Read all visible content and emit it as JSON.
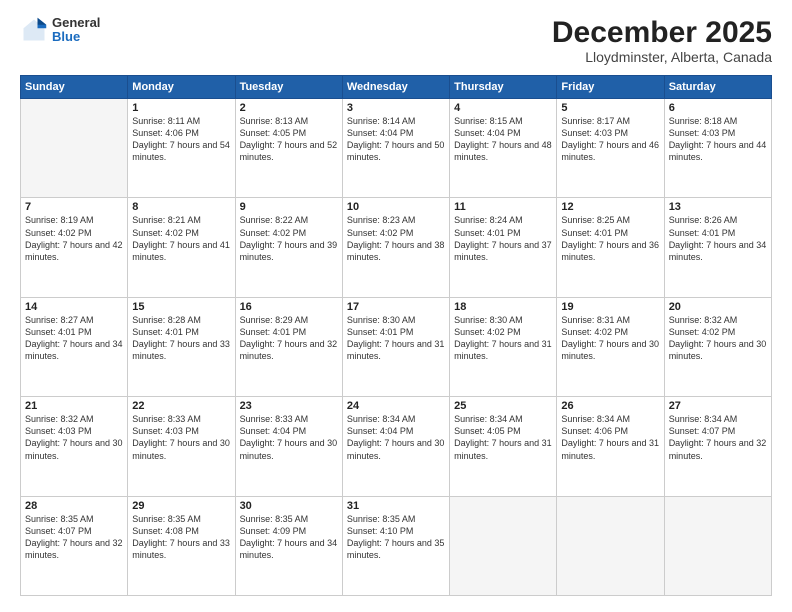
{
  "logo": {
    "general": "General",
    "blue": "Blue"
  },
  "title": "December 2025",
  "location": "Lloydminster, Alberta, Canada",
  "days_of_week": [
    "Sunday",
    "Monday",
    "Tuesday",
    "Wednesday",
    "Thursday",
    "Friday",
    "Saturday"
  ],
  "weeks": [
    [
      {
        "day": "",
        "empty": true
      },
      {
        "day": "1",
        "sunrise": "8:11 AM",
        "sunset": "4:06 PM",
        "daylight": "7 hours and 54 minutes."
      },
      {
        "day": "2",
        "sunrise": "8:13 AM",
        "sunset": "4:05 PM",
        "daylight": "7 hours and 52 minutes."
      },
      {
        "day": "3",
        "sunrise": "8:14 AM",
        "sunset": "4:04 PM",
        "daylight": "7 hours and 50 minutes."
      },
      {
        "day": "4",
        "sunrise": "8:15 AM",
        "sunset": "4:04 PM",
        "daylight": "7 hours and 48 minutes."
      },
      {
        "day": "5",
        "sunrise": "8:17 AM",
        "sunset": "4:03 PM",
        "daylight": "7 hours and 46 minutes."
      },
      {
        "day": "6",
        "sunrise": "8:18 AM",
        "sunset": "4:03 PM",
        "daylight": "7 hours and 44 minutes."
      }
    ],
    [
      {
        "day": "7",
        "sunrise": "8:19 AM",
        "sunset": "4:02 PM",
        "daylight": "7 hours and 42 minutes."
      },
      {
        "day": "8",
        "sunrise": "8:21 AM",
        "sunset": "4:02 PM",
        "daylight": "7 hours and 41 minutes."
      },
      {
        "day": "9",
        "sunrise": "8:22 AM",
        "sunset": "4:02 PM",
        "daylight": "7 hours and 39 minutes."
      },
      {
        "day": "10",
        "sunrise": "8:23 AM",
        "sunset": "4:02 PM",
        "daylight": "7 hours and 38 minutes."
      },
      {
        "day": "11",
        "sunrise": "8:24 AM",
        "sunset": "4:01 PM",
        "daylight": "7 hours and 37 minutes."
      },
      {
        "day": "12",
        "sunrise": "8:25 AM",
        "sunset": "4:01 PM",
        "daylight": "7 hours and 36 minutes."
      },
      {
        "day": "13",
        "sunrise": "8:26 AM",
        "sunset": "4:01 PM",
        "daylight": "7 hours and 34 minutes."
      }
    ],
    [
      {
        "day": "14",
        "sunrise": "8:27 AM",
        "sunset": "4:01 PM",
        "daylight": "7 hours and 34 minutes."
      },
      {
        "day": "15",
        "sunrise": "8:28 AM",
        "sunset": "4:01 PM",
        "daylight": "7 hours and 33 minutes."
      },
      {
        "day": "16",
        "sunrise": "8:29 AM",
        "sunset": "4:01 PM",
        "daylight": "7 hours and 32 minutes."
      },
      {
        "day": "17",
        "sunrise": "8:30 AM",
        "sunset": "4:01 PM",
        "daylight": "7 hours and 31 minutes."
      },
      {
        "day": "18",
        "sunrise": "8:30 AM",
        "sunset": "4:02 PM",
        "daylight": "7 hours and 31 minutes."
      },
      {
        "day": "19",
        "sunrise": "8:31 AM",
        "sunset": "4:02 PM",
        "daylight": "7 hours and 30 minutes."
      },
      {
        "day": "20",
        "sunrise": "8:32 AM",
        "sunset": "4:02 PM",
        "daylight": "7 hours and 30 minutes."
      }
    ],
    [
      {
        "day": "21",
        "sunrise": "8:32 AM",
        "sunset": "4:03 PM",
        "daylight": "7 hours and 30 minutes."
      },
      {
        "day": "22",
        "sunrise": "8:33 AM",
        "sunset": "4:03 PM",
        "daylight": "7 hours and 30 minutes."
      },
      {
        "day": "23",
        "sunrise": "8:33 AM",
        "sunset": "4:04 PM",
        "daylight": "7 hours and 30 minutes."
      },
      {
        "day": "24",
        "sunrise": "8:34 AM",
        "sunset": "4:04 PM",
        "daylight": "7 hours and 30 minutes."
      },
      {
        "day": "25",
        "sunrise": "8:34 AM",
        "sunset": "4:05 PM",
        "daylight": "7 hours and 31 minutes."
      },
      {
        "day": "26",
        "sunrise": "8:34 AM",
        "sunset": "4:06 PM",
        "daylight": "7 hours and 31 minutes."
      },
      {
        "day": "27",
        "sunrise": "8:34 AM",
        "sunset": "4:07 PM",
        "daylight": "7 hours and 32 minutes."
      }
    ],
    [
      {
        "day": "28",
        "sunrise": "8:35 AM",
        "sunset": "4:07 PM",
        "daylight": "7 hours and 32 minutes."
      },
      {
        "day": "29",
        "sunrise": "8:35 AM",
        "sunset": "4:08 PM",
        "daylight": "7 hours and 33 minutes."
      },
      {
        "day": "30",
        "sunrise": "8:35 AM",
        "sunset": "4:09 PM",
        "daylight": "7 hours and 34 minutes."
      },
      {
        "day": "31",
        "sunrise": "8:35 AM",
        "sunset": "4:10 PM",
        "daylight": "7 hours and 35 minutes."
      },
      {
        "day": "",
        "empty": true
      },
      {
        "day": "",
        "empty": true
      },
      {
        "day": "",
        "empty": true
      }
    ]
  ],
  "labels": {
    "sunrise_prefix": "Sunrise: ",
    "sunset_prefix": "Sunset: ",
    "daylight_prefix": "Daylight: "
  }
}
